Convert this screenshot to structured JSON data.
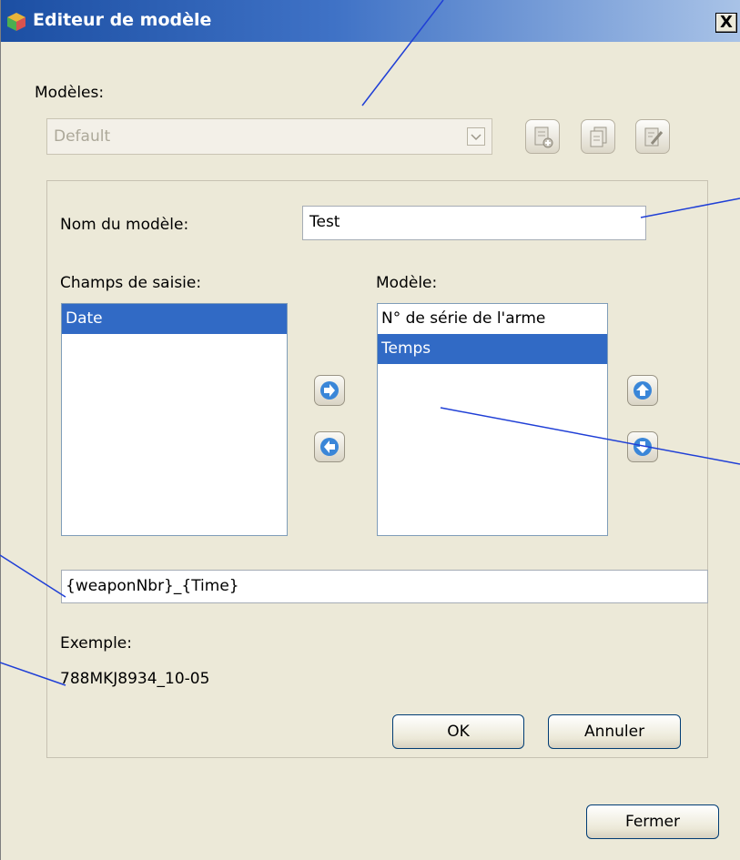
{
  "window": {
    "title": "Editeur de modèle",
    "close_label": "X"
  },
  "models": {
    "label": "Modèles:",
    "selected": "Default",
    "toolbar_icons": [
      "new-model-icon",
      "copy-model-icon",
      "edit-model-icon"
    ]
  },
  "editor": {
    "name_label": "Nom du modèle:",
    "name_value": "Test",
    "fields_label": "Champs de saisie:",
    "fields_items": [
      "Date"
    ],
    "model_label": "Modèle:",
    "model_items": [
      "N° de série de l'arme",
      "Temps"
    ],
    "pattern_value": "{weaponNbr}_{Time}",
    "example_label": "Exemple:",
    "example_value": "788MKJ8934_10-05",
    "ok_label": "OK",
    "cancel_label": "Annuler"
  },
  "footer": {
    "close_button_label": "Fermer"
  },
  "colors": {
    "title_bar": "#1c4fa3",
    "selection": "#316ac5",
    "dialog_bg": "#ece9d8",
    "callout_line": "#1f3fd6"
  }
}
